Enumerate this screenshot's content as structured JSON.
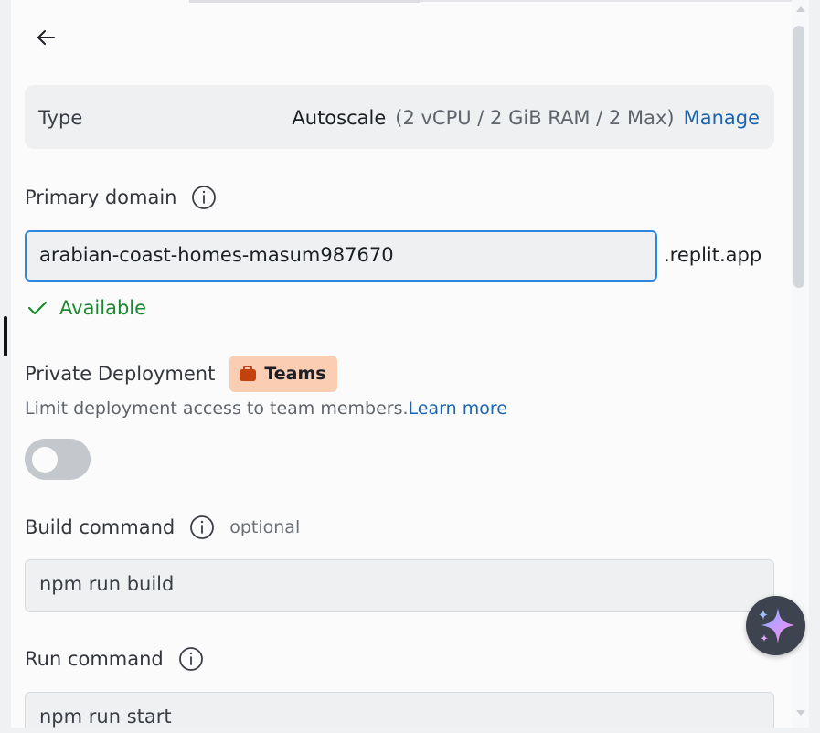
{
  "type_card": {
    "label": "Type",
    "value": "Autoscale",
    "spec": "(2 vCPU / 2 GiB RAM / 2 Max)",
    "manage": "Manage"
  },
  "primary_domain": {
    "label": "Primary domain",
    "value": "arabian-coast-homes-masum987670",
    "suffix": ".replit.app",
    "status": "Available"
  },
  "private_deployment": {
    "label": "Private Deployment",
    "badge": "Teams",
    "description": "Limit deployment access to team members.",
    "learn_more": "Learn more",
    "enabled": false
  },
  "build_command": {
    "label": "Build command",
    "optional": "optional",
    "value": "npm run build"
  },
  "run_command": {
    "label": "Run command",
    "value": "npm run start"
  },
  "colors": {
    "accent": "#2f86e0",
    "link": "#1a64b0",
    "success": "#1a8a2e",
    "badge_bg": "#fbcdb2",
    "badge_icon": "#c2410c"
  }
}
